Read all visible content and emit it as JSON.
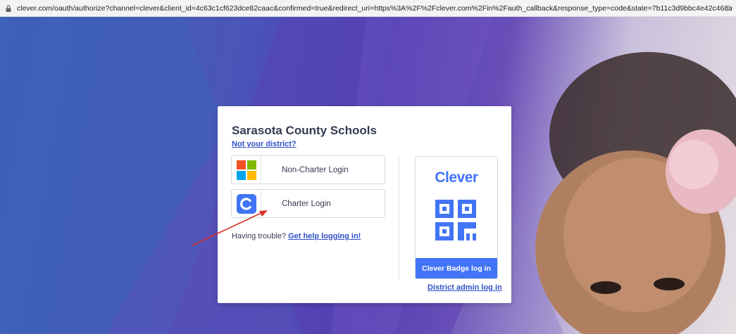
{
  "browser": {
    "url": "clever.com/oauth/authorize?channel=clever&client_id=4c63c1cf623dce82caac&confirmed=true&redirect_uri=https%3A%2F%2Fclever.com%2Fin%2Fauth_callback&response_type=code&state=7b11c3d9bbc4e42c468a28e29a3b3...",
    "lock_icon": "lock-icon",
    "star_icon": "star-icon"
  },
  "card": {
    "district_name": "Sarasota County Schools",
    "not_district_link": "Not your district?",
    "buttons": [
      {
        "label": "Non-Charter Login",
        "icon": "microsoft-logo-icon"
      },
      {
        "label": "Charter Login",
        "icon": "clever-c-icon"
      }
    ],
    "trouble_text": "Having trouble?",
    "help_link": "Get help logging in!",
    "badge": {
      "brand": "Clever",
      "qr_icon": "qr-code-icon",
      "button_label": "Clever Badge log in"
    },
    "admin_link": "District admin log in"
  },
  "annotation": {
    "arrow_color": "#d9342b"
  },
  "colors": {
    "link_blue": "#3050c8",
    "clever_blue": "#4274f6",
    "text_dark": "#363a52"
  }
}
